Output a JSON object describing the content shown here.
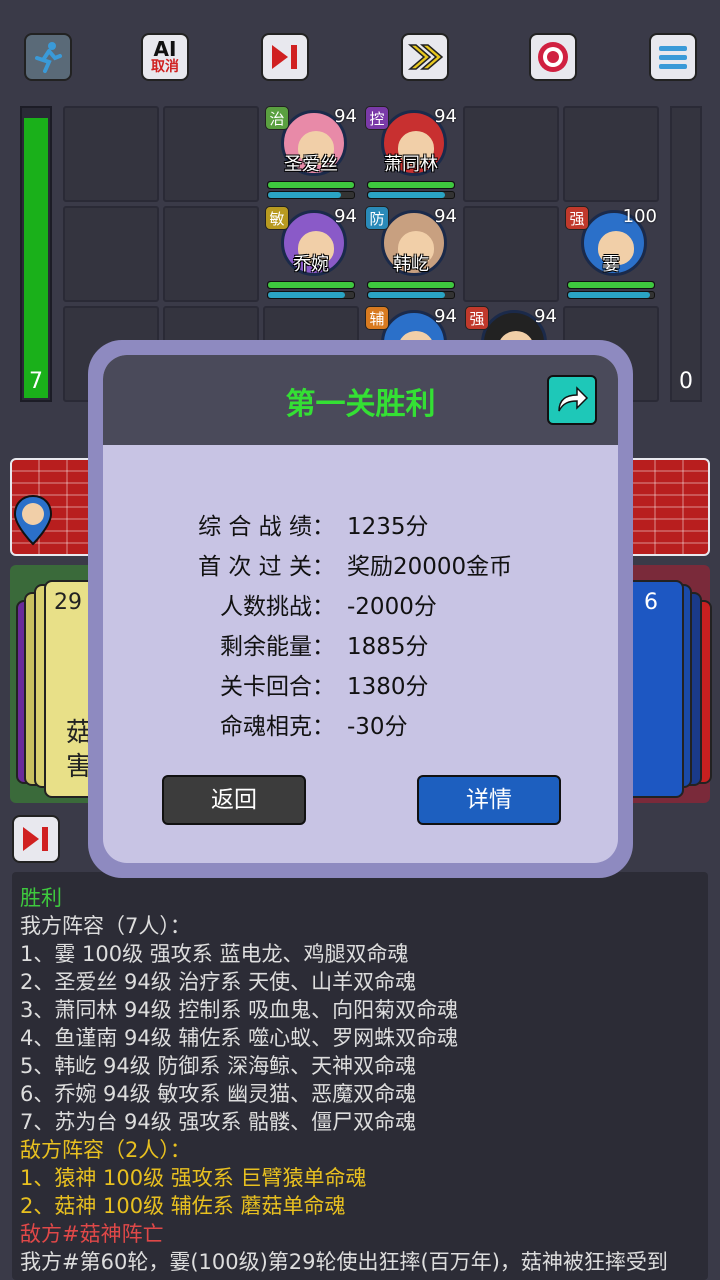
{
  "toolbar": {
    "ai_label_top": "AI",
    "ai_label_bottom": "取消"
  },
  "left_counter": "7",
  "right_counter": "0",
  "heroes": [
    {
      "tag": "治",
      "tag_color": "#5aa040",
      "level": "94",
      "name": "圣爱丝",
      "hp": 1.0,
      "mp": 0.85
    },
    {
      "tag": "控",
      "tag_color": "#7a3aa8",
      "level": "94",
      "name": "萧同林",
      "hp": 1.0,
      "mp": 0.9
    },
    {
      "tag": "敏",
      "tag_color": "#b89a20",
      "level": "94",
      "name": "乔婉",
      "hp": 1.0,
      "mp": 0.9
    },
    {
      "tag": "防",
      "tag_color": "#2a8ab8",
      "level": "94",
      "name": "韩屹",
      "hp": 1.0,
      "mp": 0.9
    },
    {
      "tag": "强",
      "tag_color": "#c0392b",
      "level": "100",
      "name": "霎",
      "hp": 1.0,
      "mp": 0.95
    },
    {
      "tag": "辅",
      "tag_color": "#d87a20",
      "level": "94",
      "name": "",
      "hp": 1.0,
      "mp": 1.0
    },
    {
      "tag": "强",
      "tag_color": "#c0392b",
      "level": "94",
      "name": "",
      "hp": 1.0,
      "mp": 1.0
    }
  ],
  "left_deck_count": "29",
  "right_deck_count": "6",
  "left_card_chars": [
    "菇",
    "害"
  ],
  "modal": {
    "title": "第一关胜利",
    "stats": [
      {
        "key": "综 合 战 绩：",
        "value": "1235分"
      },
      {
        "key": "首 次 过 关：",
        "value": "奖励20000金币"
      },
      {
        "key": "人数挑战：",
        "value": "-2000分"
      },
      {
        "key": "剩余能量：",
        "value": "1885分"
      },
      {
        "key": "关卡回合：",
        "value": "1380分"
      },
      {
        "key": "命魂相克：",
        "value": "-30分"
      }
    ],
    "back_label": "返回",
    "detail_label": "详情"
  },
  "log": {
    "lines": [
      {
        "text": "胜利",
        "color": "#3ec93e"
      },
      {
        "text": "我方阵容（7人）：",
        "color": "#dddddd"
      },
      {
        "text": "1、霎 100级 强攻系 蓝电龙、鸡腿双命魂",
        "color": "#dddddd"
      },
      {
        "text": "2、圣爱丝 94级 治疗系 天使、山羊双命魂",
        "color": "#dddddd"
      },
      {
        "text": "3、萧同林 94级 控制系 吸血鬼、向阳菊双命魂",
        "color": "#dddddd"
      },
      {
        "text": "4、鱼谨南 94级 辅佐系 噬心蚁、罗网蛛双命魂",
        "color": "#dddddd"
      },
      {
        "text": "5、韩屹 94级 防御系 深海鲸、天神双命魂",
        "color": "#dddddd"
      },
      {
        "text": "6、乔婉 94级 敏攻系 幽灵猫、恶魔双命魂",
        "color": "#dddddd"
      },
      {
        "text": "7、苏为台 94级 强攻系 骷髅、僵尸双命魂",
        "color": "#dddddd"
      },
      {
        "text": "敌方阵容（2人）：",
        "color": "#e8c020"
      },
      {
        "text": "1、猿神 100级 强攻系 巨臂猿单命魂",
        "color": "#e8c020"
      },
      {
        "text": "2、菇神 100级 辅佐系 蘑菇单命魂",
        "color": "#e8c020"
      },
      {
        "text": "敌方#菇神阵亡",
        "color": "#e04848"
      },
      {
        "text": "我方#第60轮，霎(100级)第29轮使出狂摔(百万年)，菇神被狂摔受到",
        "color": "#dddddd"
      }
    ]
  }
}
